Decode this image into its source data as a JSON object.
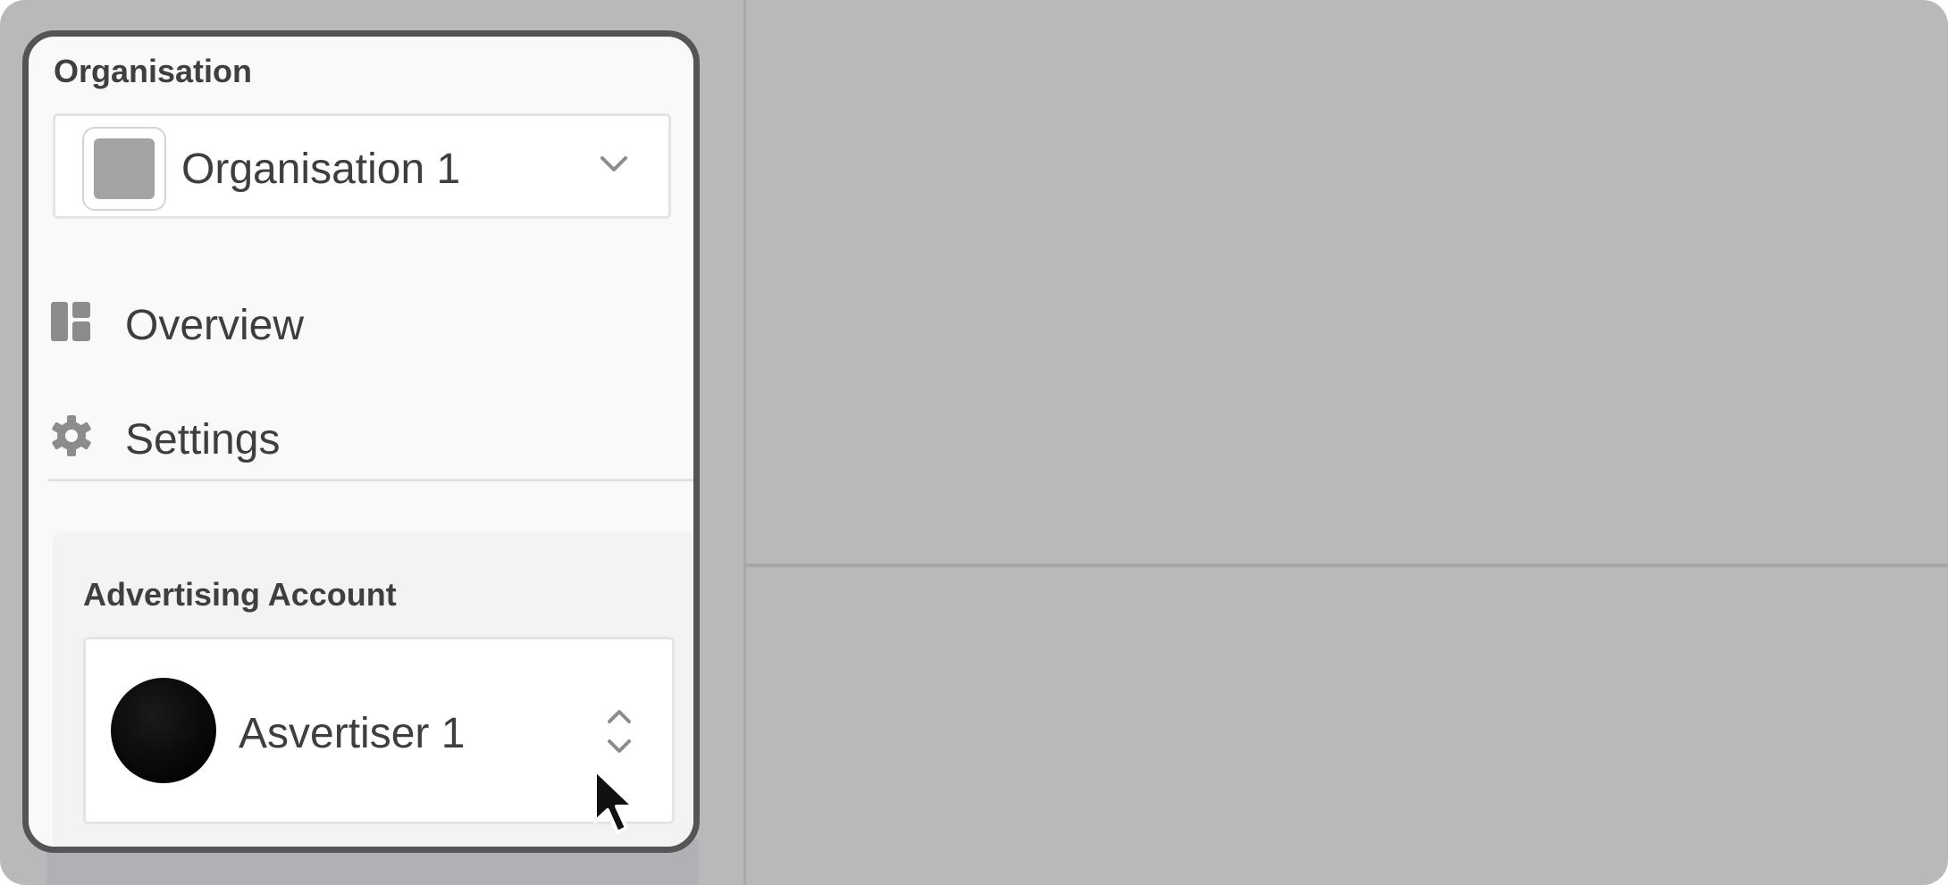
{
  "sidebar": {
    "organisation_section": {
      "label": "Organisation",
      "selected_org": "Organisation 1",
      "avatar_icon": "org-placeholder-icon",
      "dropdown_icon": "chevron-down-icon"
    },
    "nav_items": [
      {
        "label": "Overview",
        "icon": "dashboard-icon"
      },
      {
        "label": "Settings",
        "icon": "gear-icon"
      }
    ],
    "advertising_section": {
      "label": "Advertising Account",
      "selected_account": "Asvertiser 1",
      "avatar_icon": "advertiser-avatar",
      "switch_icon": "chevron-up-down-icon"
    }
  },
  "colors": {
    "app_background": "#b8b9bb",
    "sidebar_background": "#f9f9f9",
    "sidebar_border": "#555558",
    "text": "#3e3e41",
    "icon": "#8c8c8f"
  }
}
